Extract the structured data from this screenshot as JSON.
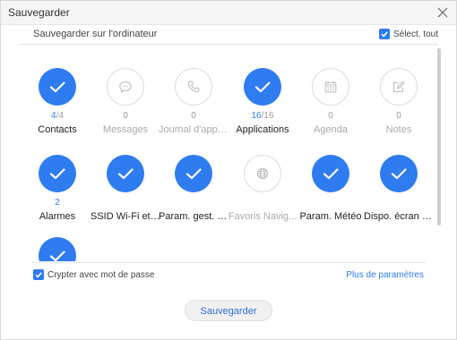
{
  "window": {
    "title": "Sauvegarder"
  },
  "header": {
    "subtitle": "Sauvegarder sur l'ordinateur",
    "select_all_label": "Sélect. tout",
    "select_all_checked": true
  },
  "colors": {
    "accent": "#2f7bf0",
    "inactive_icon": "#bdbdbd"
  },
  "items": [
    {
      "label": "Contacts",
      "selected_count": "4",
      "total_count": "/4",
      "count_text": "",
      "selected": true,
      "icon": "check-icon"
    },
    {
      "label": "Messages",
      "selected_count": "",
      "total_count": "",
      "count_text": "0",
      "selected": false,
      "icon": "message-icon"
    },
    {
      "label": "Journal d'appels",
      "selected_count": "",
      "total_count": "",
      "count_text": "0",
      "selected": false,
      "icon": "phone-icon"
    },
    {
      "label": "Applications",
      "selected_count": "16",
      "total_count": "/16",
      "count_text": "",
      "selected": true,
      "icon": "check-icon"
    },
    {
      "label": "Agenda",
      "selected_count": "",
      "total_count": "",
      "count_text": "0",
      "selected": false,
      "icon": "calendar-icon"
    },
    {
      "label": "Notes",
      "selected_count": "",
      "total_count": "",
      "count_text": "0",
      "selected": false,
      "icon": "note-icon"
    },
    {
      "label": "Alarmes",
      "selected_count": "2",
      "total_count": "",
      "count_text": "",
      "selected": true,
      "icon": "check-icon"
    },
    {
      "label": "SSID Wi-Fi et ...",
      "selected_count": "",
      "total_count": "",
      "count_text": "",
      "selected": true,
      "icon": "check-icon"
    },
    {
      "label": "Param. gest. tél.",
      "selected_count": "",
      "total_count": "",
      "count_text": "",
      "selected": true,
      "icon": "check-icon"
    },
    {
      "label": "Favoris Navig...",
      "selected_count": "",
      "total_count": "",
      "count_text": "",
      "selected": false,
      "icon": "globe-icon"
    },
    {
      "label": "Param. Météo",
      "selected_count": "",
      "total_count": "",
      "count_text": "",
      "selected": true,
      "icon": "check-icon"
    },
    {
      "label": "Dispo. écran a...",
      "selected_count": "",
      "total_count": "",
      "count_text": "",
      "selected": true,
      "icon": "check-icon"
    },
    {
      "label": "",
      "selected_count": "",
      "total_count": "",
      "count_text": "",
      "selected": true,
      "icon": "check-icon"
    }
  ],
  "footer": {
    "encrypt_label": "Crypter avec mot de passe",
    "encrypt_checked": true,
    "more_params_label": "Plus de paramètres",
    "save_label": "Sauvegarder"
  }
}
